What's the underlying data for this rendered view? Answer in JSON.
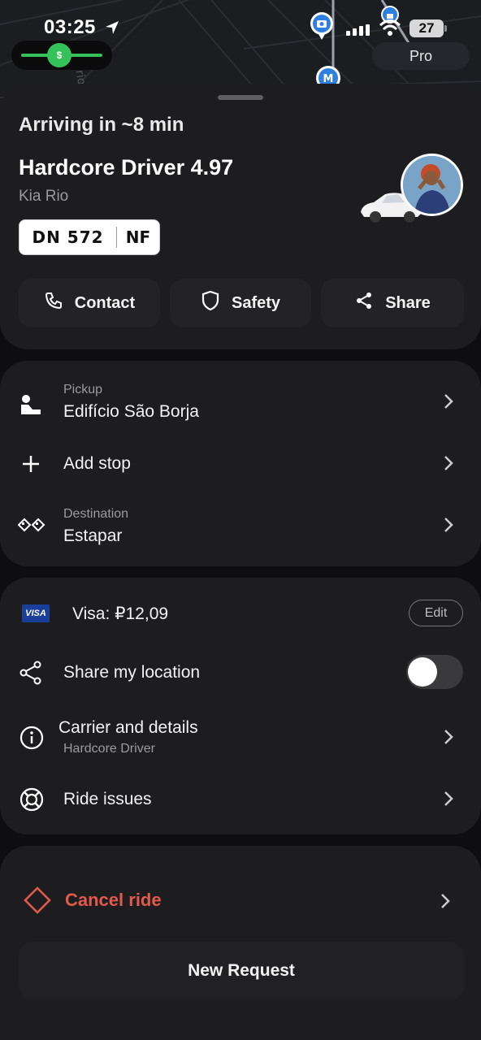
{
  "status_bar": {
    "time": "03:25",
    "battery": "27",
    "pay_symbol": "$",
    "pro_label": "Pro"
  },
  "map": {
    "street_label": "rio"
  },
  "trip": {
    "arriving": "Arriving in ~8 min",
    "driver": "Hardcore Driver 4.97",
    "car": "Kia Rio",
    "plate_number": "DN 572",
    "plate_suffix": "NF",
    "actions": {
      "contact": "Contact",
      "safety": "Safety",
      "share": "Share"
    }
  },
  "route": {
    "pickup_label": "Pickup",
    "pickup_value": "Edifício São Borja",
    "add_stop": "Add stop",
    "destination_label": "Destination",
    "destination_value": "Estapar"
  },
  "options": {
    "payment_brand": "VISA",
    "payment": "Visa: ₽12,09",
    "edit": "Edit",
    "share_location": "Share my location",
    "share_location_on": false,
    "carrier": "Carrier and details",
    "carrier_sub": "Hardcore Driver",
    "ride_issues": "Ride issues"
  },
  "footer": {
    "cancel": "Cancel ride",
    "new_request": "New Request"
  },
  "colors": {
    "accent_green": "#35c25a",
    "cancel_red": "#e15a4b",
    "card": "#1d1d20"
  }
}
